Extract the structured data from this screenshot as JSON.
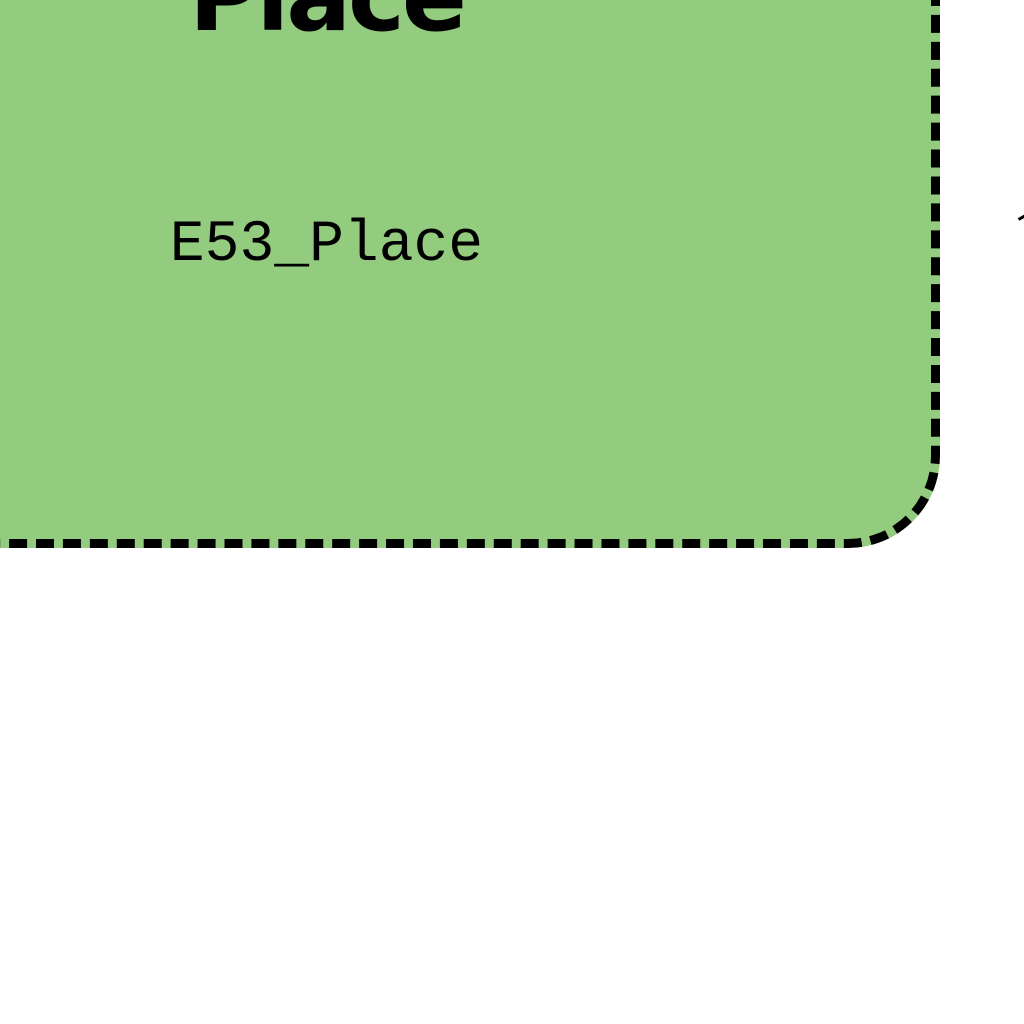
{
  "node": {
    "title": "Place",
    "subtitle": "E53_Place",
    "fill_color": "#93cc7f",
    "border_color": "#000000",
    "border_style": "dashed"
  }
}
